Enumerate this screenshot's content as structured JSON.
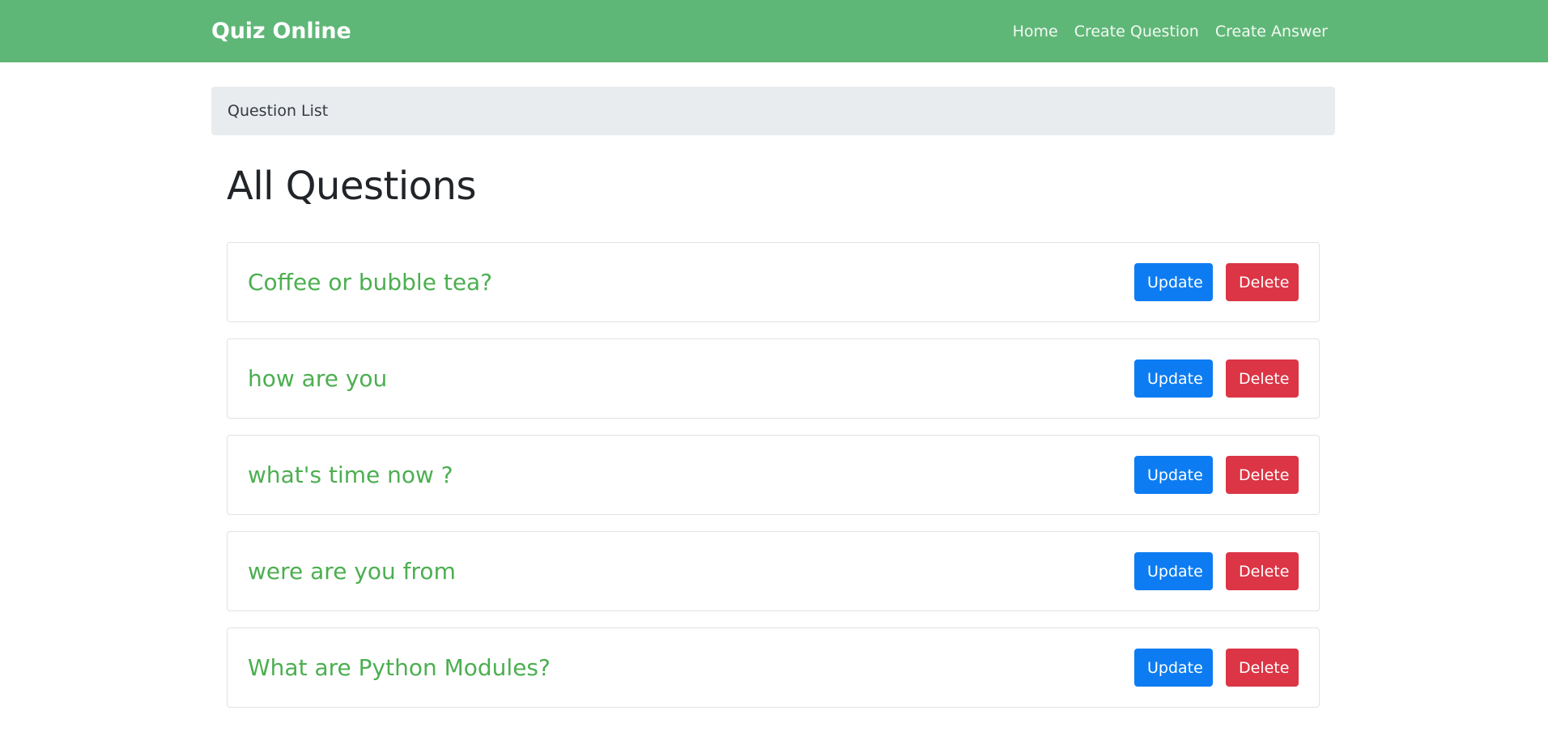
{
  "navbar": {
    "brand": "Quiz Online",
    "links": [
      "Home",
      "Create Question",
      "Create Answer"
    ]
  },
  "breadcrumb": "Question List",
  "page_title": "All Questions",
  "questions": [
    {
      "text": "Coffee or bubble tea?",
      "update_label": "Update",
      "delete_label": "Delete"
    },
    {
      "text": "how are you",
      "update_label": "Update",
      "delete_label": "Delete"
    },
    {
      "text": "what's time now ?",
      "update_label": "Update",
      "delete_label": "Delete"
    },
    {
      "text": "were are you from",
      "update_label": "Update",
      "delete_label": "Delete"
    },
    {
      "text": "What are Python Modules?",
      "update_label": "Update",
      "delete_label": "Delete"
    }
  ],
  "colors": {
    "brand": "#5fb777",
    "question_text": "#4caf50",
    "update_button": "#0d7cf2",
    "delete_button": "#dc3545",
    "breadcrumb_bg": "#e9ecef"
  }
}
